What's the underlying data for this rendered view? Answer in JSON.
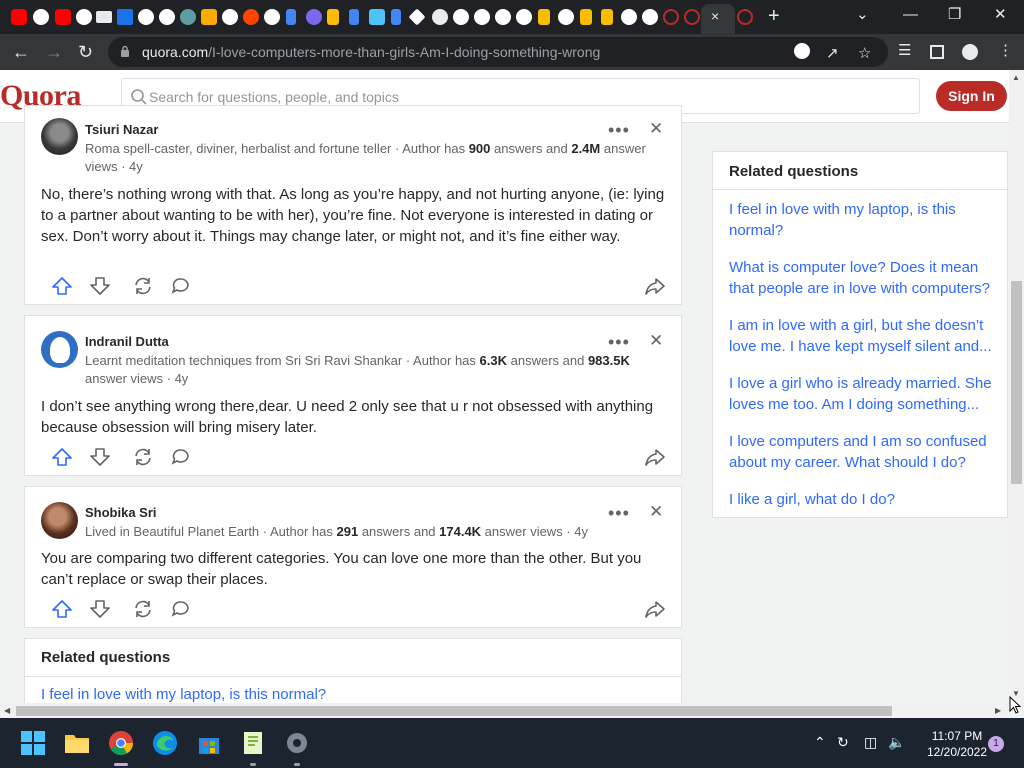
{
  "browser": {
    "tab_close_label": "×",
    "new_tab_label": "+",
    "omnibox": {
      "domain": "quora.com",
      "path": "/I-love-computers-more-than-girls-Am-I-doing-something-wrong"
    }
  },
  "header": {
    "logo": "Quora",
    "search_placeholder": "Search for questions, people, and topics",
    "signin_label": "Sign In"
  },
  "answers": [
    {
      "author": "Tsiuri Nazar",
      "cred_prefix": "Roma spell-caster, diviner, herbalist and fortune teller · Author has ",
      "answers_count": "900",
      "cred_mid": " answers and ",
      "views_count": "2.4M",
      "cred_suffix": " answer views · 4y",
      "text": "No, there’s nothing wrong with that. As long as you’re happy, and not hurting anyone, (ie: lying to a partner about wanting to be with her), you’re fine. Not everyone is interested in dating or sex. Don’t worry about it. Things may change later, or might not, and it’s fine either way."
    },
    {
      "author": "Indranil Dutta",
      "cred_prefix": "Learnt meditation techniques from Sri Sri Ravi Shankar · Author has ",
      "answers_count": "6.3K",
      "cred_mid": " answers and ",
      "views_count": "983.5K",
      "cred_suffix": " answer views · 4y",
      "text": "I don’t see anything wrong there,dear. U need 2 only see that u r not obsessed with anything because obsession will bring misery later."
    },
    {
      "author": "Shobika Sri",
      "cred_prefix": "Lived in Beautiful Planet Earth · Author has ",
      "answers_count": "291",
      "cred_mid": " answers and ",
      "views_count": "174.4K",
      "cred_suffix": " answer views · 4y",
      "text": "You are comparing two different categories. You can love one more than the other. But you can’t replace or swap their places."
    }
  ],
  "related_bottom": {
    "title": "Related questions",
    "first_link": "I feel in love with my laptop, is this normal?"
  },
  "sidebar": {
    "title": "Related questions",
    "links": [
      "I feel in love with my laptop, is this normal?",
      "What is computer love? Does it mean that people are in love with computers?",
      "I am in love with a girl, but she doesn’t love me. I have kept myself silent and...",
      "I love a girl who is already married. She loves me too. Am I doing something...",
      "I love computers and I am so confused about my career. What should I do?",
      "I like a girl, what do I do?"
    ]
  },
  "taskbar": {
    "time": "11:07 PM",
    "date": "12/20/2022",
    "notification_count": "1"
  },
  "colors": {
    "brand": "#b92b27",
    "link": "#2e69ff",
    "upvote": "#2e69ff"
  }
}
